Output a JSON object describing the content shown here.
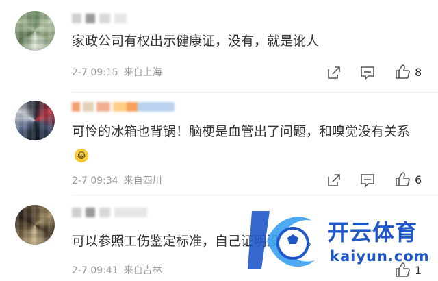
{
  "comments": [
    {
      "text": "家政公司有权出示健康证，没有，就是讹人",
      "time": "2-7 09:15",
      "location": "来自上海",
      "likes": "8"
    },
    {
      "text": "可怜的冰箱也背锅！脑梗是血管出了问题，和嗅觉没有关系",
      "emoji": "😂",
      "time": "2-7 09:34",
      "location": "来自四川",
      "likes": "6"
    },
    {
      "text": "可以参照工伤鉴定标准，自己证明没有用。",
      "time": "2-7 09:41",
      "location": "来自吉林",
      "likes": "1"
    }
  ],
  "watermark": {
    "title": "开云体育",
    "subtitle": "kaiyun.com",
    "color": "#1f57c9"
  },
  "icons": [
    "share-icon",
    "comment-icon",
    "like-icon"
  ]
}
